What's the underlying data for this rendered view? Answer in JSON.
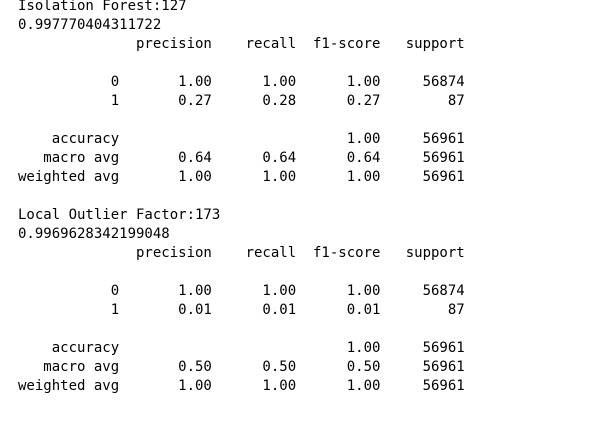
{
  "output_lines": [
    "Isolation Forest:127",
    "0.997770404311722",
    "              precision    recall  f1-score   support",
    "",
    "           0       1.00      1.00      1.00     56874",
    "           1       0.27      0.28      0.27        87",
    "",
    "    accuracy                           1.00     56961",
    "   macro avg       0.64      0.64      0.64     56961",
    "weighted avg       1.00      1.00      1.00     56961",
    "",
    "Local Outlier Factor:173",
    "0.9969628342199048",
    "              precision    recall  f1-score   support",
    "",
    "           0       1.00      1.00      1.00     56874",
    "           1       0.01      0.01      0.01        87",
    "",
    "    accuracy                           1.00     56961",
    "   macro avg       0.50      0.50      0.50     56961",
    "weighted avg       1.00      1.00      1.00     56961"
  ]
}
